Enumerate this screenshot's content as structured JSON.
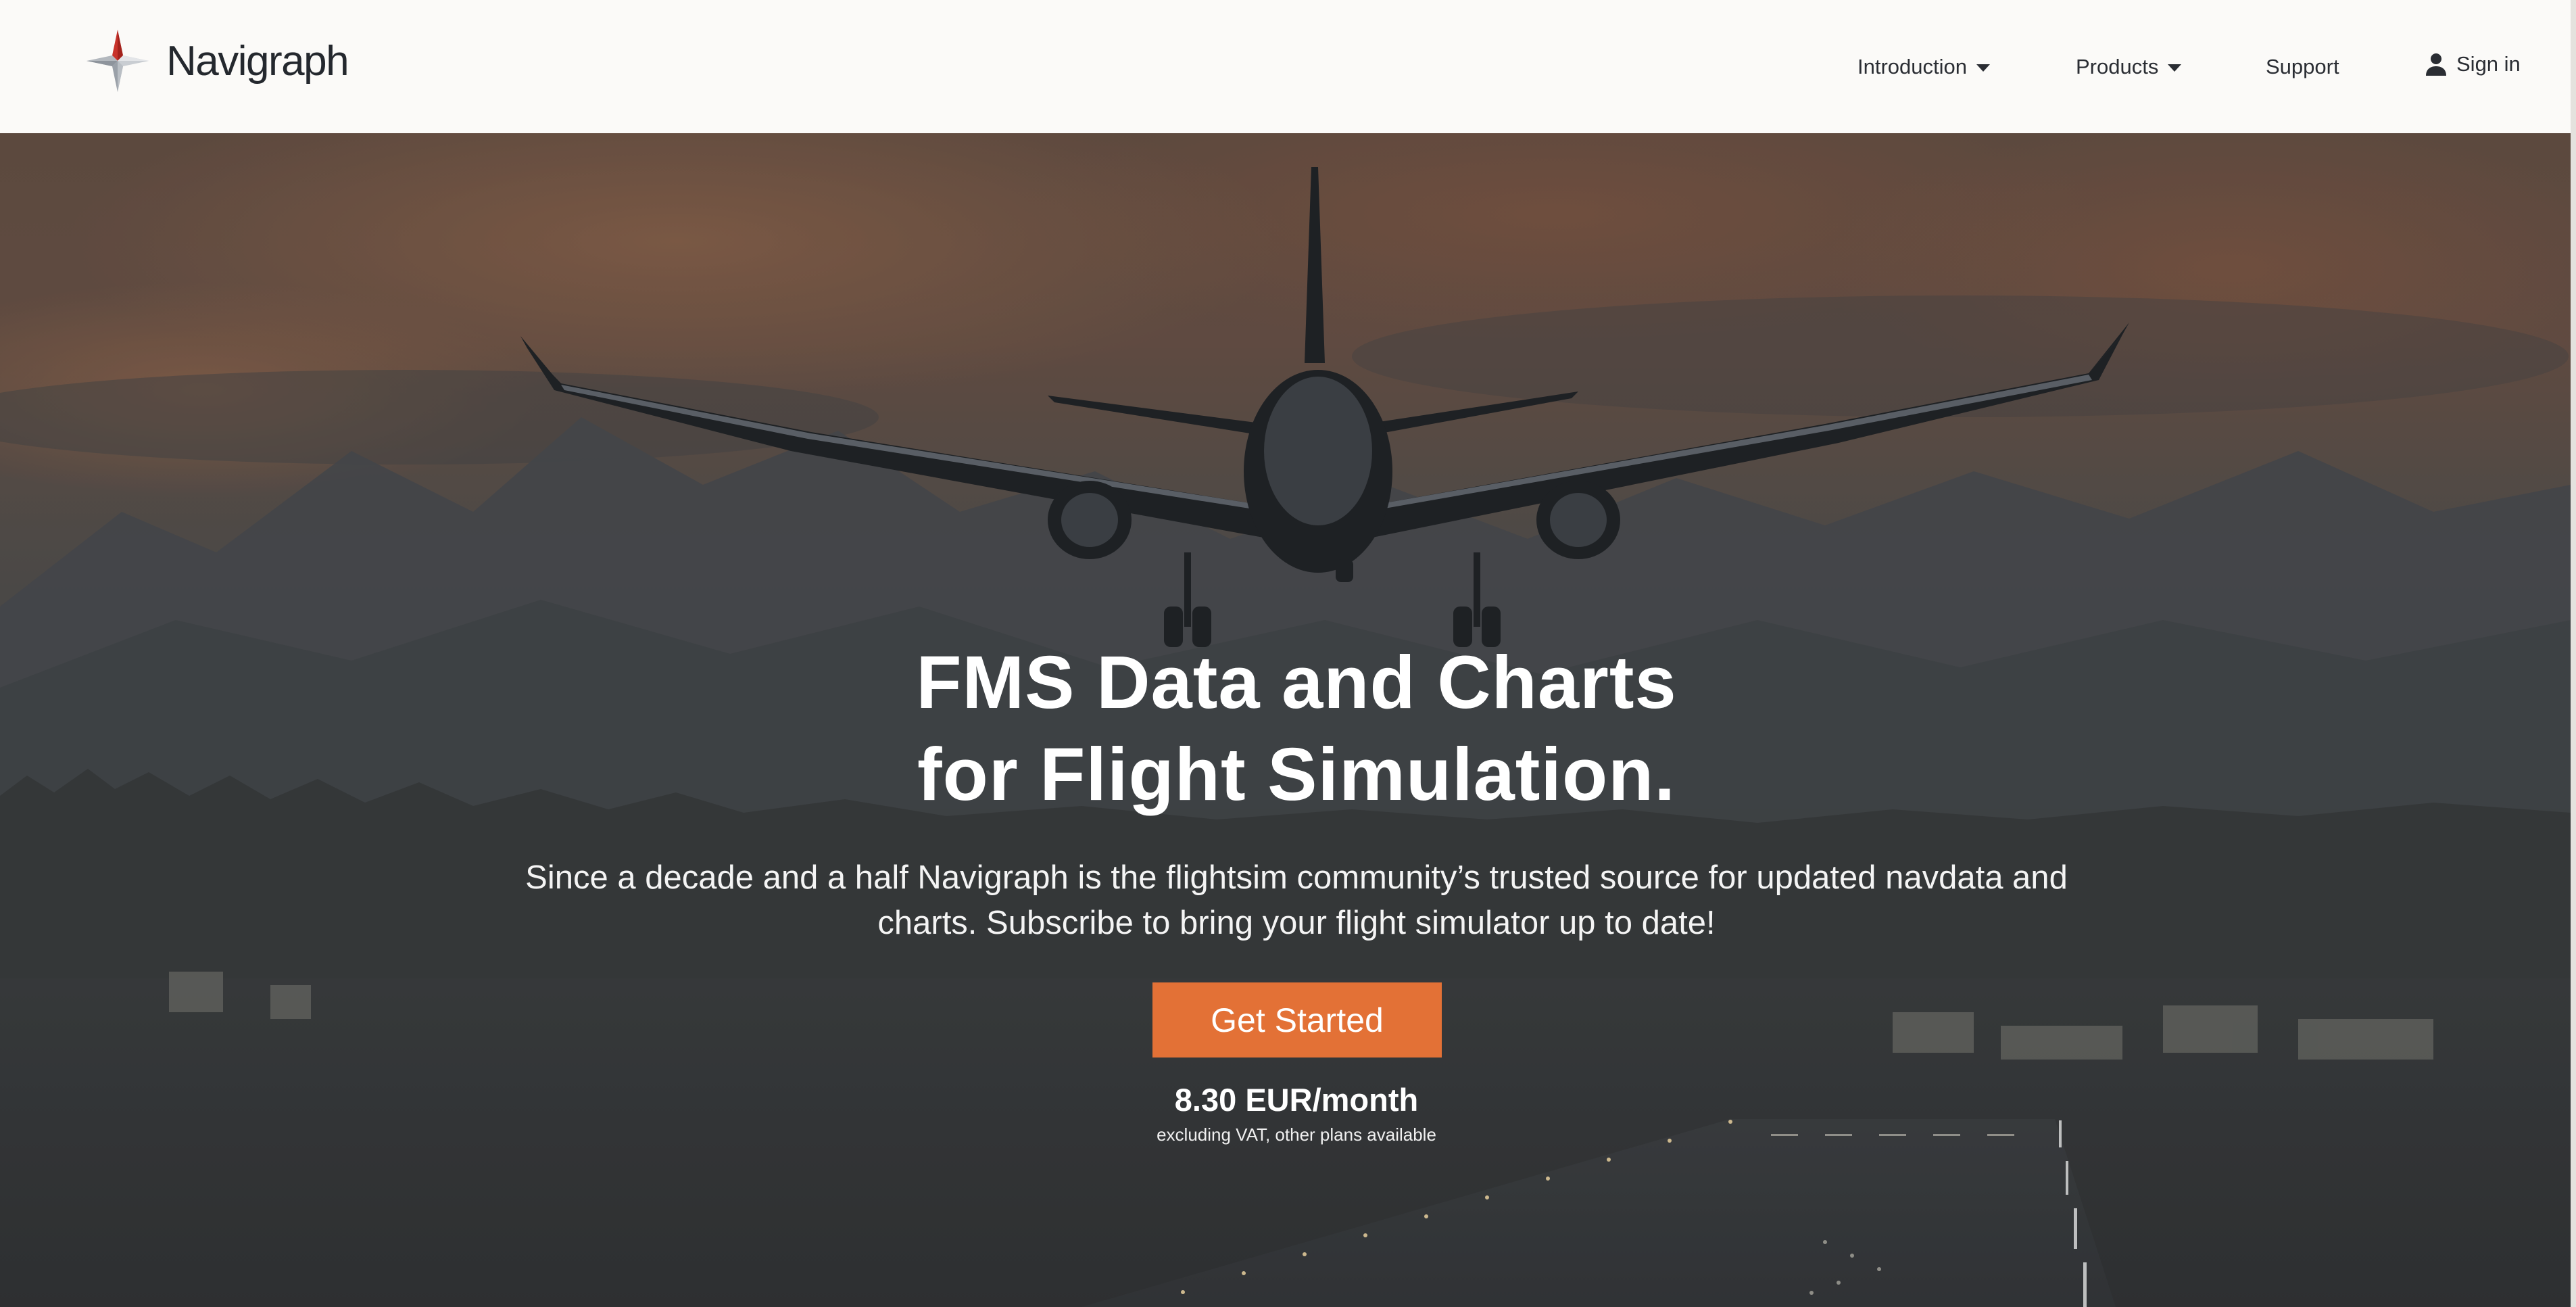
{
  "brand": {
    "name": "Navigraph",
    "logo_icon": "compass-star-icon"
  },
  "nav": {
    "items": [
      {
        "label": "Introduction",
        "has_dropdown": true
      },
      {
        "label": "Products",
        "has_dropdown": true
      },
      {
        "label": "Support",
        "has_dropdown": false
      }
    ],
    "signin": {
      "label": "Sign in",
      "icon": "user-icon"
    }
  },
  "hero": {
    "title_line1": "FMS Data and Charts",
    "title_line2": "for Flight Simulation.",
    "subtitle": "Since a decade and a half Navigraph is the flightsim community’s trusted source for updated navdata and charts. Subscribe to bring your flight simulator up to date!",
    "cta_label": "Get Started",
    "price": "8.30 EUR/month",
    "price_note": "excluding VAT, other plans available"
  },
  "colors": {
    "accent": "#e37136",
    "header_bg": "#fbfaf8",
    "text_dark": "#24282e",
    "logo_red": "#c8332b",
    "logo_gray": "#9aa0a8"
  }
}
